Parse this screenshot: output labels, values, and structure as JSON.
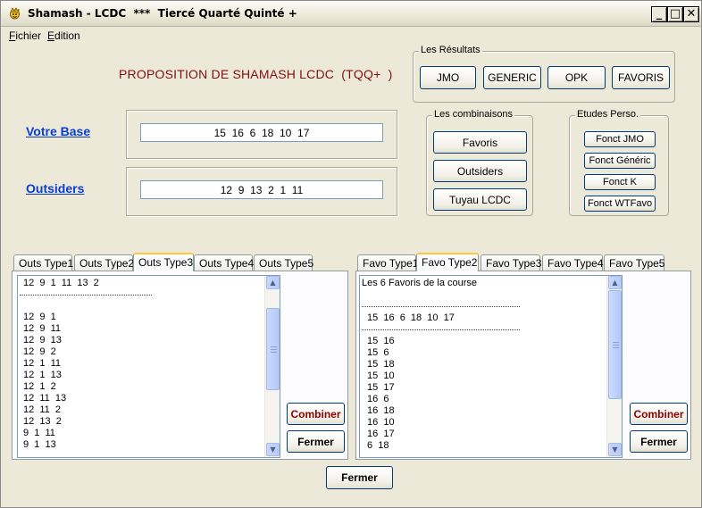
{
  "window": {
    "title": "Shamash - LCDC  ***  Tiercé Quarté Quinté +",
    "minimize": "_",
    "maximize": "□",
    "close": "✕"
  },
  "menu": {
    "fichier": {
      "first": "F",
      "rest": "ichier"
    },
    "edition": {
      "first": "E",
      "rest": "dition"
    }
  },
  "heading": "PROPOSITION DE SHAMASH LCDC  (TQQ+  )",
  "resultats": {
    "title": "Les Résultats",
    "buttons": [
      "JMO",
      "GENERIC",
      "OPK",
      "FAVORIS"
    ]
  },
  "combinaisons": {
    "title": "Les combinaisons",
    "buttons": [
      "Favoris",
      "Outsiders",
      "Tuyau LCDC"
    ]
  },
  "etudes": {
    "title": "Etudes Perso.",
    "buttons": [
      "Fonct JMO",
      "Fonct Généric",
      "Fonct K",
      "Fonct WTFavo"
    ]
  },
  "base": {
    "label": "Votre Base",
    "value": "15  16  6  18  10  17"
  },
  "outsiders": {
    "label": "Outsiders",
    "value": "12  9  13  2  1  11"
  },
  "outs_tabs": [
    "Outs Type1",
    "Outs Type2",
    "Outs Type3",
    "Outs Type4",
    "Outs Type5"
  ],
  "outs_active_tab": 2,
  "outs_list": {
    "header": "12  9  1  11  13  2",
    "items": [
      "12  9  1",
      "12  9  11",
      "12  9  13",
      "12  9  2",
      "12  1  11",
      "12  1  13",
      "12  1  2",
      "12  11  13",
      "12  11  2",
      "12  13  2",
      "9  1  11",
      "9  1  13"
    ]
  },
  "favo_tabs": [
    "Favo Type1",
    "Favo Type2",
    "Favo Type3",
    "Favo Type4",
    "Favo Type5"
  ],
  "favo_active_tab": 1,
  "favo_list": {
    "title": "Les 6 Favoris de la course",
    "header": "15  16  6  18  10  17",
    "items": [
      "15  16",
      "15  6",
      "15  18",
      "15  10",
      "15  17",
      "16  6",
      "16  18",
      "16  10",
      "16  17",
      "6  18"
    ]
  },
  "actions": {
    "combiner": "Combiner",
    "fermer": "Fermer",
    "fermer_main": "Fermer"
  }
}
